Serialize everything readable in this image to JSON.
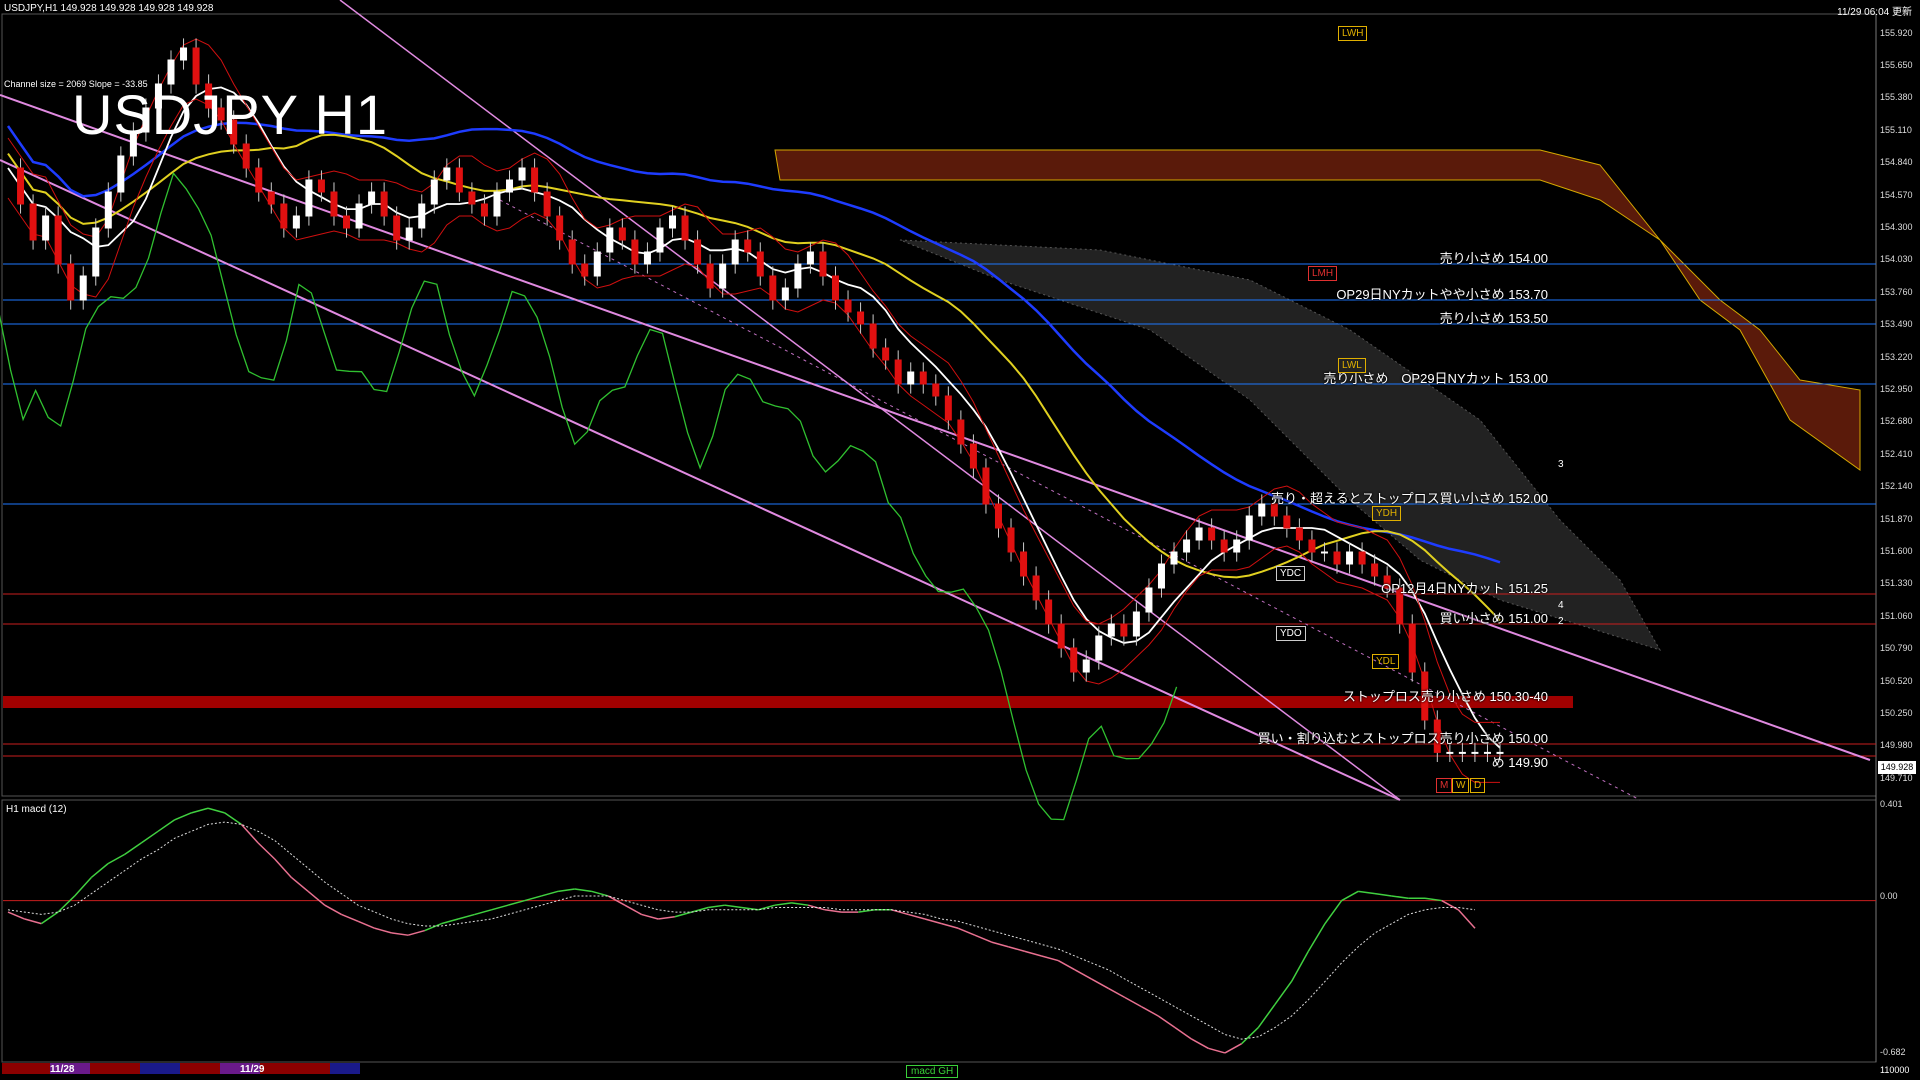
{
  "header": {
    "symbol_line": "USDJPY,H1  149.928 149.928 149.928 149.928",
    "datetime": "11/29 06:04 更新",
    "channel_info": "Channel size = 2069 Slope = -33.85"
  },
  "overlay_title": "USDJPY H1",
  "price_axis": {
    "ticks": [
      "155.920",
      "155.650",
      "155.380",
      "155.110",
      "154.840",
      "154.570",
      "154.300",
      "154.030",
      "153.760",
      "153.490",
      "153.220",
      "152.950",
      "152.680",
      "152.410",
      "152.140",
      "151.870",
      "151.600",
      "151.330",
      "151.060",
      "150.790",
      "150.520",
      "150.250",
      "149.980",
      "149.710"
    ],
    "current_price_tag": "149.928"
  },
  "macd_axis": {
    "ticks": [
      "0.401",
      "0.00",
      "-0.682"
    ]
  },
  "macd_label": "H1  macd (12)",
  "date_labels": [
    "11/28",
    "11/29"
  ],
  "bottom_status": "macd GH",
  "bottom_right": "110000",
  "levels": [
    {
      "label": "売り小さめ 154.00",
      "price": 154.0,
      "color": "#1e78ff"
    },
    {
      "label": "OP29日NYカットやや小さめ 153.70",
      "price": 153.7,
      "color": "#1e78ff"
    },
    {
      "label": "売り小さめ 153.50",
      "price": 153.5,
      "color": "#1e78ff"
    },
    {
      "label": "売り小さめ　OP29日NYカット 153.00",
      "price": 153.0,
      "color": "#1e78ff"
    },
    {
      "label": "売り・超えるとストップロス買い小さめ 152.00",
      "price": 152.0,
      "color": "#1e78ff"
    },
    {
      "label": "OP12月4日NYカット 151.25",
      "price": 151.25,
      "color": "#c81e1e"
    },
    {
      "label": "買い小さめ 151.00",
      "price": 151.0,
      "color": "#c81e1e"
    },
    {
      "label": "ストップロス売り小さめ 150.30-40",
      "price": 150.35,
      "color": "#a00000"
    },
    {
      "label": "買い・割り込むとストップロス売り小さめ 150.00",
      "price": 150.0,
      "color": "#c81e1e"
    },
    {
      "label": "め 149.90",
      "price": 149.9,
      "color": "#c81e1e"
    }
  ],
  "box_labels": [
    {
      "text": "LWH",
      "style": "orange"
    },
    {
      "text": "LMH",
      "style": "red"
    },
    {
      "text": "LWL",
      "style": "orange"
    },
    {
      "text": "YDH",
      "style": "orange"
    },
    {
      "text": "YDC",
      "style": "white"
    },
    {
      "text": "YDO",
      "style": "white"
    },
    {
      "text": "YDL",
      "style": "orange"
    },
    {
      "text": "W",
      "style": "orange"
    },
    {
      "text": "D",
      "style": "orange"
    },
    {
      "text": "M",
      "style": "red"
    }
  ],
  "counts": [
    "3",
    "4",
    "2",
    "1"
  ],
  "chart_data": {
    "type": "line",
    "title": "USDJPY H1",
    "ylim": [
      149.6,
      156.05
    ],
    "x_count": 120,
    "price_close": [
      154.8,
      154.5,
      154.2,
      154.4,
      154.0,
      153.7,
      153.9,
      154.3,
      154.6,
      154.9,
      155.1,
      155.3,
      155.5,
      155.7,
      155.8,
      155.5,
      155.3,
      155.2,
      155.0,
      154.8,
      154.6,
      154.5,
      154.3,
      154.4,
      154.7,
      154.6,
      154.4,
      154.3,
      154.5,
      154.6,
      154.4,
      154.2,
      154.3,
      154.5,
      154.7,
      154.8,
      154.6,
      154.5,
      154.4,
      154.6,
      154.7,
      154.8,
      154.6,
      154.4,
      154.2,
      154.0,
      153.9,
      154.1,
      154.3,
      154.2,
      154.0,
      154.1,
      154.3,
      154.4,
      154.2,
      154.0,
      153.8,
      154.0,
      154.2,
      154.1,
      153.9,
      153.7,
      153.8,
      154.0,
      154.1,
      153.9,
      153.7,
      153.6,
      153.5,
      153.3,
      153.2,
      153.0,
      153.1,
      153.0,
      152.9,
      152.7,
      152.5,
      152.3,
      152.0,
      151.8,
      151.6,
      151.4,
      151.2,
      151.0,
      150.8,
      150.6,
      150.7,
      150.9,
      151.0,
      150.9,
      151.1,
      151.3,
      151.5,
      151.6,
      151.7,
      151.8,
      151.7,
      151.6,
      151.7,
      151.9,
      152.0,
      151.9,
      151.8,
      151.7,
      151.6,
      151.6,
      151.5,
      151.6,
      151.5,
      151.4,
      151.3,
      151.0,
      150.6,
      150.2,
      149.93,
      149.93,
      149.93,
      149.93,
      149.93,
      149.93
    ],
    "macd_main": [
      -0.05,
      -0.08,
      -0.1,
      -0.05,
      0.02,
      0.1,
      0.16,
      0.2,
      0.25,
      0.3,
      0.35,
      0.38,
      0.4,
      0.38,
      0.33,
      0.25,
      0.18,
      0.1,
      0.04,
      -0.02,
      -0.06,
      -0.09,
      -0.12,
      -0.14,
      -0.15,
      -0.13,
      -0.1,
      -0.08,
      -0.06,
      -0.04,
      -0.02,
      0.0,
      0.02,
      0.04,
      0.05,
      0.04,
      0.02,
      -0.02,
      -0.06,
      -0.08,
      -0.07,
      -0.05,
      -0.03,
      -0.02,
      -0.03,
      -0.04,
      -0.02,
      -0.01,
      -0.02,
      -0.04,
      -0.05,
      -0.05,
      -0.04,
      -0.04,
      -0.06,
      -0.08,
      -0.1,
      -0.12,
      -0.15,
      -0.18,
      -0.2,
      -0.22,
      -0.24,
      -0.26,
      -0.3,
      -0.34,
      -0.38,
      -0.42,
      -0.46,
      -0.5,
      -0.55,
      -0.6,
      -0.64,
      -0.66,
      -0.62,
      -0.55,
      -0.45,
      -0.35,
      -0.22,
      -0.1,
      0.0,
      0.04,
      0.03,
      0.02,
      0.01,
      0.01,
      0.0,
      -0.04,
      -0.12
    ],
    "macd_signal": [
      -0.04,
      -0.05,
      -0.06,
      -0.05,
      -0.02,
      0.03,
      0.08,
      0.13,
      0.18,
      0.22,
      0.27,
      0.3,
      0.33,
      0.34,
      0.33,
      0.3,
      0.26,
      0.2,
      0.14,
      0.08,
      0.03,
      -0.02,
      -0.05,
      -0.08,
      -0.1,
      -0.11,
      -0.11,
      -0.1,
      -0.09,
      -0.08,
      -0.06,
      -0.04,
      -0.02,
      0.0,
      0.02,
      0.02,
      0.02,
      0.0,
      -0.02,
      -0.04,
      -0.05,
      -0.05,
      -0.04,
      -0.04,
      -0.04,
      -0.04,
      -0.03,
      -0.03,
      -0.03,
      -0.03,
      -0.04,
      -0.04,
      -0.04,
      -0.04,
      -0.05,
      -0.06,
      -0.08,
      -0.09,
      -0.11,
      -0.13,
      -0.15,
      -0.17,
      -0.19,
      -0.21,
      -0.24,
      -0.27,
      -0.3,
      -0.34,
      -0.38,
      -0.42,
      -0.46,
      -0.5,
      -0.54,
      -0.58,
      -0.6,
      -0.59,
      -0.55,
      -0.5,
      -0.43,
      -0.35,
      -0.27,
      -0.2,
      -0.14,
      -0.1,
      -0.06,
      -0.04,
      -0.03,
      -0.03,
      -0.04
    ],
    "macd_ylim": [
      -0.682,
      0.401
    ]
  }
}
